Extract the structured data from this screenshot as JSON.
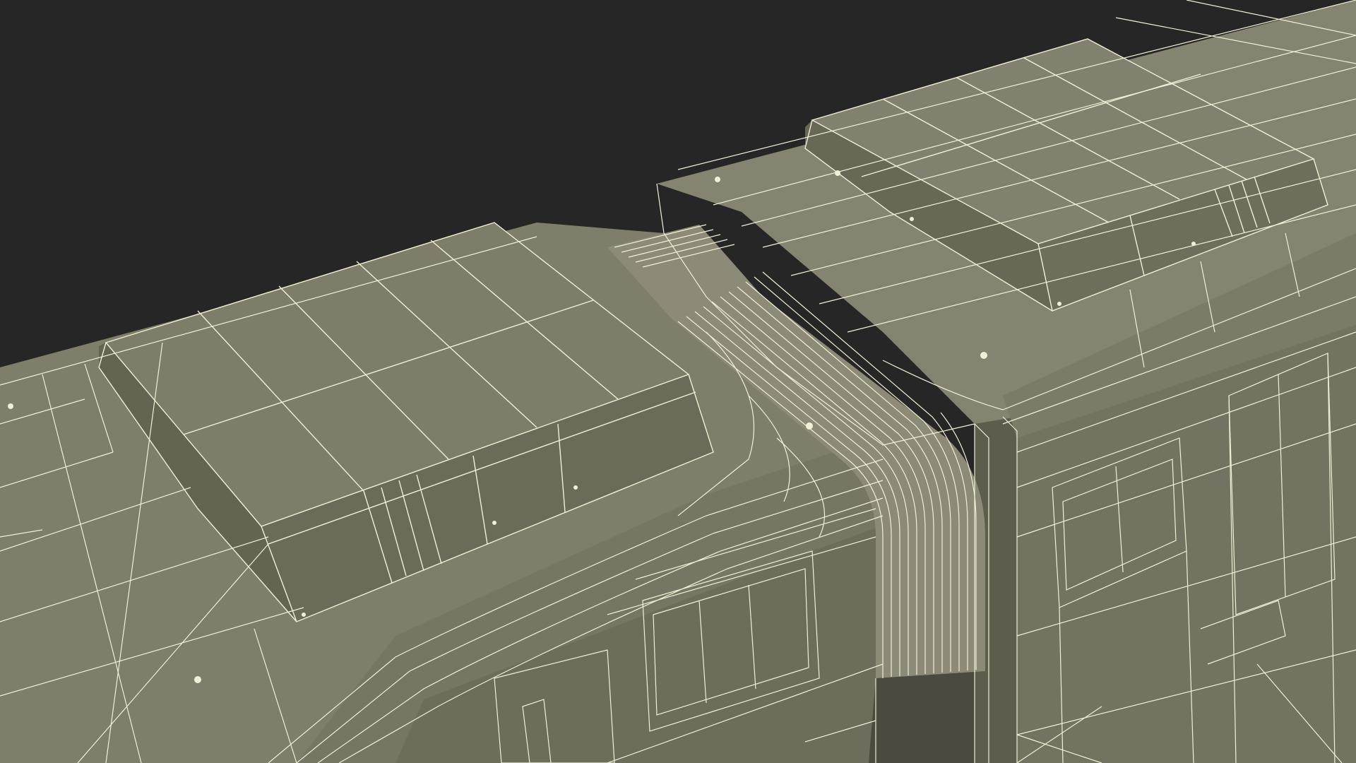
{
  "scene": {
    "subject": "railcar-wireframe",
    "render_mode": "wireframe-on-shaded",
    "colors": {
      "background": "#262626",
      "body_top": "#84826f",
      "body_side": "#737260",
      "body_dark": "#626151",
      "panel": "#7d7c69",
      "panel_side": "#6b6a58",
      "bellows": "#8c8a76",
      "wire": "#f2efd6"
    }
  }
}
